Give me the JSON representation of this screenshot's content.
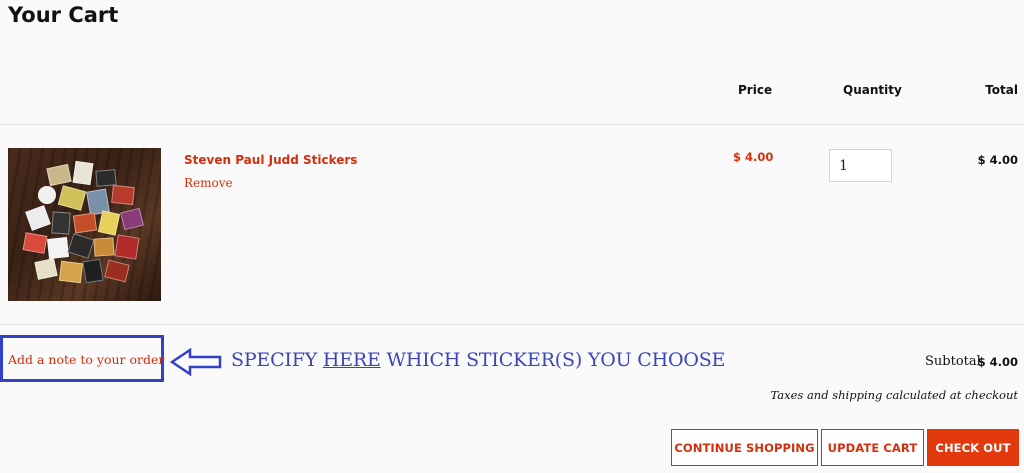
{
  "page": {
    "title": "Your Cart"
  },
  "table_headers": {
    "price": "Price",
    "quantity": "Quantity",
    "total": "Total"
  },
  "item": {
    "name": "Steven Paul Judd Stickers",
    "remove_label": "Remove",
    "price": "$ 4.00",
    "quantity": "1",
    "line_total": "$ 4.00"
  },
  "note": {
    "link_label": "Add a note to your order"
  },
  "annotation": {
    "text_before": "SPECIFY ",
    "text_underlined": "HERE",
    "text_after": " WHICH STICKER(S) YOU CHOOSE",
    "color": "#3b45b8"
  },
  "summary": {
    "subtotal_label": "Subtotal",
    "subtotal_value": "$ 4.00",
    "tax_note": "Taxes and shipping calculated at checkout"
  },
  "buttons": {
    "continue_shopping": "CONTINUE SHOPPING",
    "update_cart": "UPDATE CART",
    "check_out": "CHECK OUT"
  },
  "colors": {
    "accent": "#d42f0d",
    "checkout_bg": "#e23a0c",
    "annotation_border": "#3341c9"
  }
}
